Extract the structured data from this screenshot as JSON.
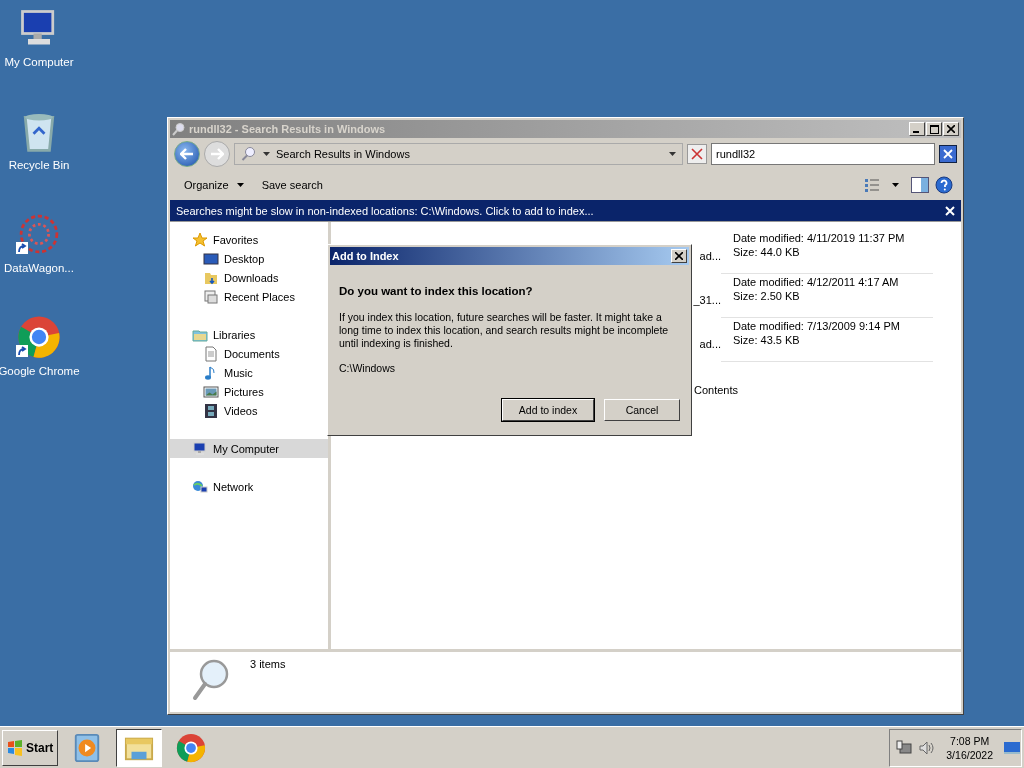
{
  "desktop_icons": [
    {
      "label": "My Computer",
      "kind": "computer",
      "shortcut": false
    },
    {
      "label": "Recycle Bin",
      "kind": "bin",
      "shortcut": false
    },
    {
      "label": "DataWagon...",
      "kind": "datawagon",
      "shortcut": true
    },
    {
      "label": "Google Chrome",
      "kind": "chrome",
      "shortcut": true
    }
  ],
  "explorer": {
    "title": "rundll32 - Search Results in Windows",
    "breadcrumb": "Search Results in Windows",
    "search_value": "rundll32",
    "toolbar": [
      {
        "label": "Organize",
        "dropdown": true
      },
      {
        "label": "Save search",
        "dropdown": false
      }
    ],
    "infobar": "Searches might be slow in non-indexed locations: C:\\Windows. Click to add to index...",
    "nav": [
      {
        "label": "Favorites",
        "kind": "star",
        "selected": false,
        "children": [
          {
            "label": "Desktop",
            "kind": "desktop",
            "selected": false
          },
          {
            "label": "Downloads",
            "kind": "downloads",
            "selected": false
          },
          {
            "label": "Recent Places",
            "kind": "recent",
            "selected": false
          }
        ]
      },
      {
        "label": "Libraries",
        "kind": "libraries",
        "selected": false,
        "children": [
          {
            "label": "Documents",
            "kind": "document",
            "selected": false
          },
          {
            "label": "Music",
            "kind": "music",
            "selected": false
          },
          {
            "label": "Pictures",
            "kind": "pictures",
            "selected": false
          },
          {
            "label": "Videos",
            "kind": "videos",
            "selected": false
          }
        ]
      },
      {
        "label": "My Computer",
        "kind": "computer",
        "selected": true
      },
      {
        "label": "Network",
        "kind": "network",
        "selected": false
      }
    ],
    "results": [
      {
        "name": "ad...",
        "date": "Date modified: 4/11/2019 11:37 PM",
        "size": "Size: 44.0 KB"
      },
      {
        "name": "_31...",
        "date": "Date modified: 4/12/2011 4:17 AM",
        "size": "Size: 2.50 KB"
      },
      {
        "name": "ad...",
        "date": "Date modified: 7/13/2009 9:14 PM",
        "size": "Size: 43.5 KB"
      }
    ],
    "search_again": "Contents",
    "status": "3 items"
  },
  "dialog": {
    "title": "Add to Index",
    "heading": "Do you want to index this location?",
    "body": "If you index this location, future searches will be faster. It might take a long time to index this location, and search results might be incomplete until indexing is finished.",
    "path": "C:\\Windows",
    "buttons": [
      {
        "label": "Add to index",
        "default": true
      },
      {
        "label": "Cancel",
        "default": false
      }
    ]
  },
  "taskbar": {
    "start": "Start",
    "apps": [
      {
        "kind": "media",
        "selected": false
      },
      {
        "kind": "folder",
        "selected": true
      },
      {
        "kind": "chrome",
        "selected": false
      }
    ],
    "time": "7:08 PM",
    "date": "3/16/2022"
  }
}
